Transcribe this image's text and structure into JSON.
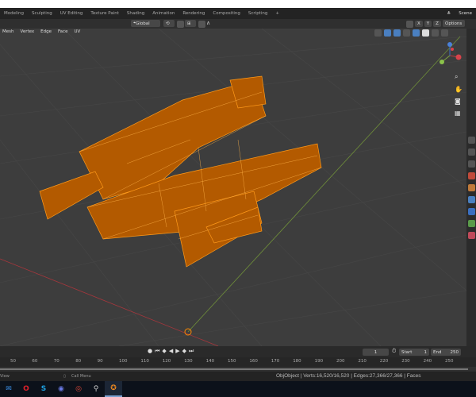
{
  "workspace_tabs": [
    "Modeling",
    "Sculpting",
    "UV Editing",
    "Texture Paint",
    "Shading",
    "Animation",
    "Rendering",
    "Compositing",
    "Scripting"
  ],
  "add_tab": "+",
  "scene_label": "Scene",
  "header": {
    "orientation": "Global",
    "options_label": "Options",
    "axes": [
      "X",
      "Y",
      "Z"
    ]
  },
  "edit_menu": [
    "Mesh",
    "Vertex",
    "Edge",
    "Face",
    "UV"
  ],
  "timeline": {
    "current_frame": "1",
    "start_label": "Start",
    "start": "1",
    "end_label": "End",
    "end": "250",
    "ticks": [
      "50",
      "60",
      "70",
      "80",
      "90",
      "100",
      "110",
      "120",
      "130",
      "140",
      "150",
      "160",
      "170",
      "180",
      "190",
      "200",
      "210",
      "220",
      "230",
      "240",
      "250"
    ]
  },
  "status": {
    "left": "View",
    "middle": "Call Menu",
    "right": "ObjObject | Verts:16,520/16,520 | Edges:27,366/27,366 | Faces"
  },
  "colors": {
    "accent": "#ff8a00",
    "x_axis": "#c0393f",
    "y_axis": "#7fa640"
  }
}
